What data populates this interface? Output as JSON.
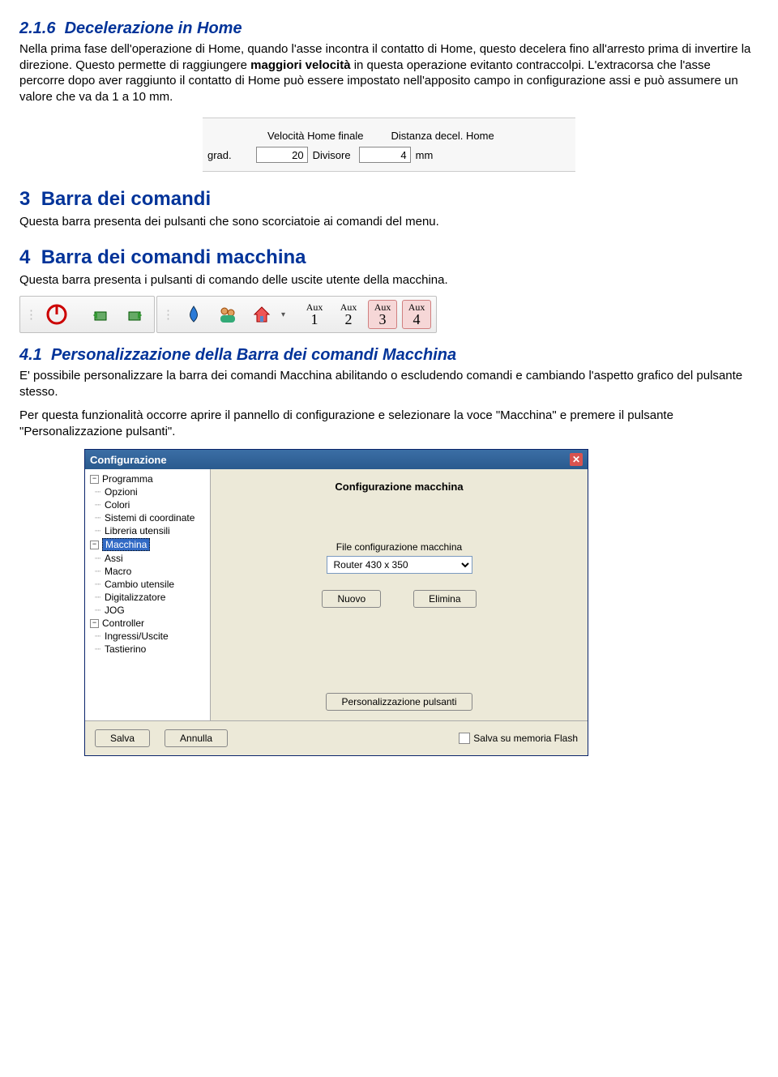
{
  "s216": {
    "num": "2.1.6",
    "title": "Decelerazione in Home",
    "p1a": "Nella prima fase dell'operazione di Home, quando l'asse incontra il contatto di Home, questo decelera fino all'arresto prima di invertire la direzione. Questo permette di raggiungere ",
    "p1b": "maggiori velocità",
    "p1c": " in questa operazione evitanto contraccolpi. L'extracorsa che l'asse percorre dopo aver raggiunto il contatto di Home può essere impostato nell'apposito campo in configurazione assi e può assumere un valore che va da 1 a 10 mm."
  },
  "ss1": {
    "h1": "Velocità Home finale",
    "h2": "Distanza decel. Home",
    "grad": "grad.",
    "val1": "20",
    "div": "Divisore",
    "val2": "4",
    "mm": "mm"
  },
  "s3": {
    "num": "3",
    "title": "Barra dei comandi",
    "p": "Questa barra presenta dei pulsanti che sono scorciatoie ai comandi del menu."
  },
  "s4": {
    "num": "4",
    "title": "Barra dei comandi macchina",
    "p": "Questa barra presenta i pulsanti di comando delle uscite utente della macchina."
  },
  "toolbar": {
    "aux": "Aux",
    "n1": "1",
    "n2": "2",
    "n3": "3",
    "n4": "4"
  },
  "s41": {
    "num": "4.1",
    "title": "Personalizzazione della Barra dei comandi Macchina",
    "p1": "E' possibile personalizzare la barra dei comandi Macchina abilitando o escludendo comandi e cambiando l'aspetto grafico del pulsante stesso.",
    "p2": "Per questa funzionalità occorre aprire il pannello di configurazione e selezionare la voce \"Macchina\" e premere il pulsante \"Personalizzazione pulsanti\"."
  },
  "dlg": {
    "title": "Configurazione",
    "heading": "Configurazione macchina",
    "filelabel": "File configurazione macchina",
    "fileval": "Router 430 x 350",
    "nuovo": "Nuovo",
    "elimina": "Elimina",
    "pers": "Personalizzazione pulsanti",
    "salva": "Salva",
    "annulla": "Annulla",
    "flash": "Salva su memoria Flash",
    "tree": {
      "programma": "Programma",
      "opzioni": "Opzioni",
      "colori": "Colori",
      "sistemi": "Sistemi di coordinate",
      "libreria": "Libreria utensili",
      "macchina": "Macchina",
      "assi": "Assi",
      "macro": "Macro",
      "cambio": "Cambio utensile",
      "digit": "Digitalizzatore",
      "jog": "JOG",
      "controller": "Controller",
      "io": "Ingressi/Uscite",
      "tast": "Tastierino"
    }
  }
}
